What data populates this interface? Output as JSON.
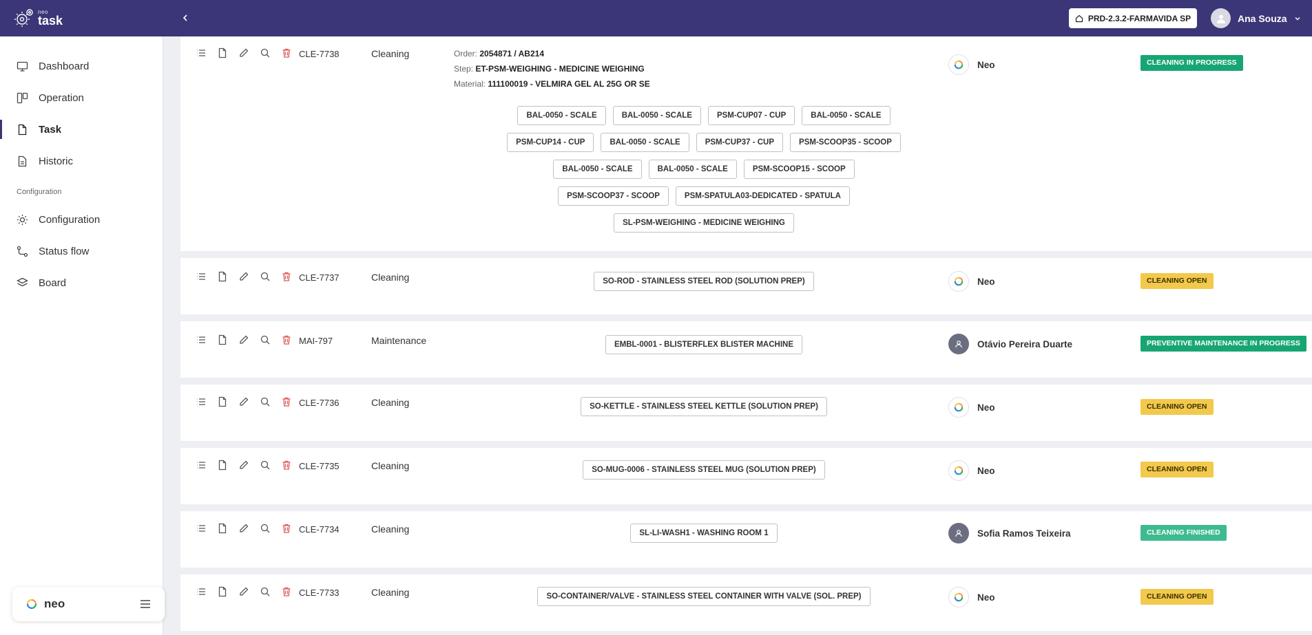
{
  "app": {
    "logo_small": "neo",
    "logo_big": "task"
  },
  "header": {
    "environment": "PRD-2.3.2-FARMAVIDA SP",
    "user_name": "Ana Souza"
  },
  "sidebar": {
    "items": [
      {
        "label": "Dashboard",
        "icon": "monitor-icon"
      },
      {
        "label": "Operation",
        "icon": "kanban-icon"
      },
      {
        "label": "Task",
        "icon": "file-icon",
        "active": true
      },
      {
        "label": "Historic",
        "icon": "document-icon"
      }
    ],
    "section_label": "Configuration",
    "config_items": [
      {
        "label": "Configuration",
        "icon": "sun-gear-icon"
      },
      {
        "label": "Status flow",
        "icon": "route-icon"
      },
      {
        "label": "Board",
        "icon": "layers-icon"
      }
    ],
    "footer_label": "neo"
  },
  "colors": {
    "header_bg": "#3b3677",
    "status_in_progress": "#17a673",
    "status_open": "#f2c94c",
    "status_finished": "#3dbb8f"
  },
  "tasks": [
    {
      "code": "CLE-7738",
      "type": "Cleaning",
      "order_label": "Order:",
      "order": "2054871 / AB214",
      "step_label": "Step:",
      "step": "ET-PSM-WEIGHING - MEDICINE WEIGHING",
      "material_label": "Material:",
      "material": "111100019 - VELMIRA GEL AL 25G OR SE",
      "chip_rows": [
        [
          "BAL-0050 - SCALE",
          "BAL-0050 - SCALE",
          "PSM-CUP07 - CUP",
          "BAL-0050 - SCALE"
        ],
        [
          "PSM-CUP14 - CUP",
          "BAL-0050 - SCALE",
          "PSM-CUP37 - CUP",
          "PSM-SCOOP35 - SCOOP"
        ],
        [
          "BAL-0050 - SCALE",
          "BAL-0050 - SCALE",
          "PSM-SCOOP15 - SCOOP"
        ],
        [
          "PSM-SCOOP37 - SCOOP",
          "PSM-SPATULA03-DEDICATED - SPATULA"
        ],
        [
          "SL-PSM-WEIGHING - MEDICINE WEIGHING"
        ]
      ],
      "responsible": "Neo",
      "responsible_type": "neo",
      "status": "CLEANING IN PROGRESS",
      "status_kind": "green"
    },
    {
      "code": "CLE-7737",
      "type": "Cleaning",
      "chip_rows": [
        [
          "SO-ROD - STAINLESS STEEL ROD (SOLUTION PREP)"
        ]
      ],
      "responsible": "Neo",
      "responsible_type": "neo",
      "status": "CLEANING OPEN",
      "status_kind": "yellow"
    },
    {
      "code": "MAI-797",
      "type": "Maintenance",
      "chip_rows": [
        [
          "EMBL-0001 - BLISTERFLEX BLISTER MACHINE"
        ]
      ],
      "responsible": "Otávio Pereira Duarte",
      "responsible_type": "person",
      "status": "PREVENTIVE MAINTENANCE IN PROGRESS",
      "status_kind": "green"
    },
    {
      "code": "CLE-7736",
      "type": "Cleaning",
      "chip_rows": [
        [
          "SO-KETTLE - STAINLESS STEEL KETTLE (SOLUTION PREP)"
        ]
      ],
      "responsible": "Neo",
      "responsible_type": "neo",
      "status": "CLEANING OPEN",
      "status_kind": "yellow"
    },
    {
      "code": "CLE-7735",
      "type": "Cleaning",
      "chip_rows": [
        [
          "SO-MUG-0006 - STAINLESS STEEL MUG (SOLUTION PREP)"
        ]
      ],
      "responsible": "Neo",
      "responsible_type": "neo",
      "status": "CLEANING OPEN",
      "status_kind": "yellow"
    },
    {
      "code": "CLE-7734",
      "type": "Cleaning",
      "chip_rows": [
        [
          "SL-LI-WASH1 - WASHING ROOM 1"
        ]
      ],
      "responsible": "Sofia Ramos Teixeira",
      "responsible_type": "person",
      "status": "CLEANING FINISHED",
      "status_kind": "teal"
    },
    {
      "code": "CLE-7733",
      "type": "Cleaning",
      "chip_rows": [
        [
          "SO-CONTAINER/VALVE - STAINLESS STEEL CONTAINER WITH VALVE (SOL. PREP)"
        ]
      ],
      "responsible": "Neo",
      "responsible_type": "neo",
      "status": "CLEANING OPEN",
      "status_kind": "yellow"
    }
  ]
}
